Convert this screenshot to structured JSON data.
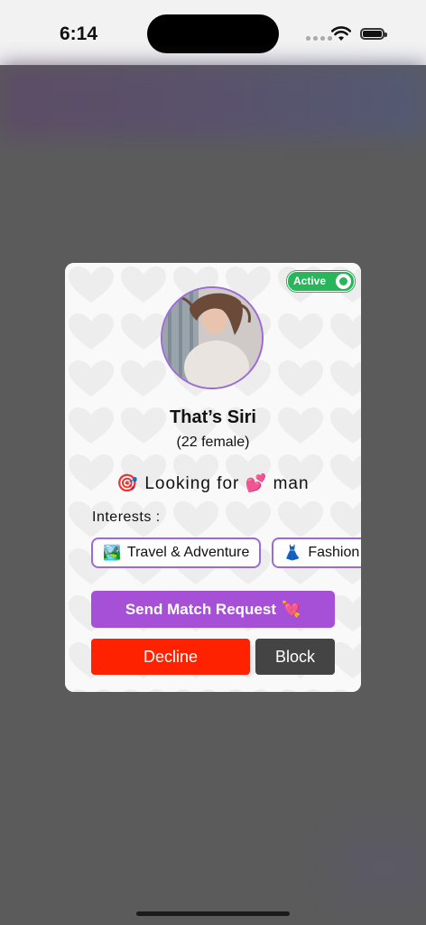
{
  "status_bar": {
    "time": "6:14"
  },
  "card": {
    "status_badge": "Active",
    "name": "That’s Siri",
    "age_gender": "(22 female)",
    "looking_for": {
      "emoji_start": "🎯",
      "text_before": "Looking for",
      "emoji_mid": "💕",
      "text_after": "man"
    },
    "interests_label": "Interests :",
    "interests": [
      {
        "emoji": "🏞️",
        "label": "Travel & Adventure"
      },
      {
        "emoji": "👗",
        "label": "Fashion"
      }
    ],
    "send_button": {
      "label": "Send Match Request",
      "emoji": "💘"
    },
    "decline_button": "Decline",
    "block_button": "Block"
  },
  "colors": {
    "accent": "#a550d6",
    "active": "#29b55a",
    "decline": "#ff2200",
    "block": "#444444",
    "overlay": "#5b5b5c"
  }
}
